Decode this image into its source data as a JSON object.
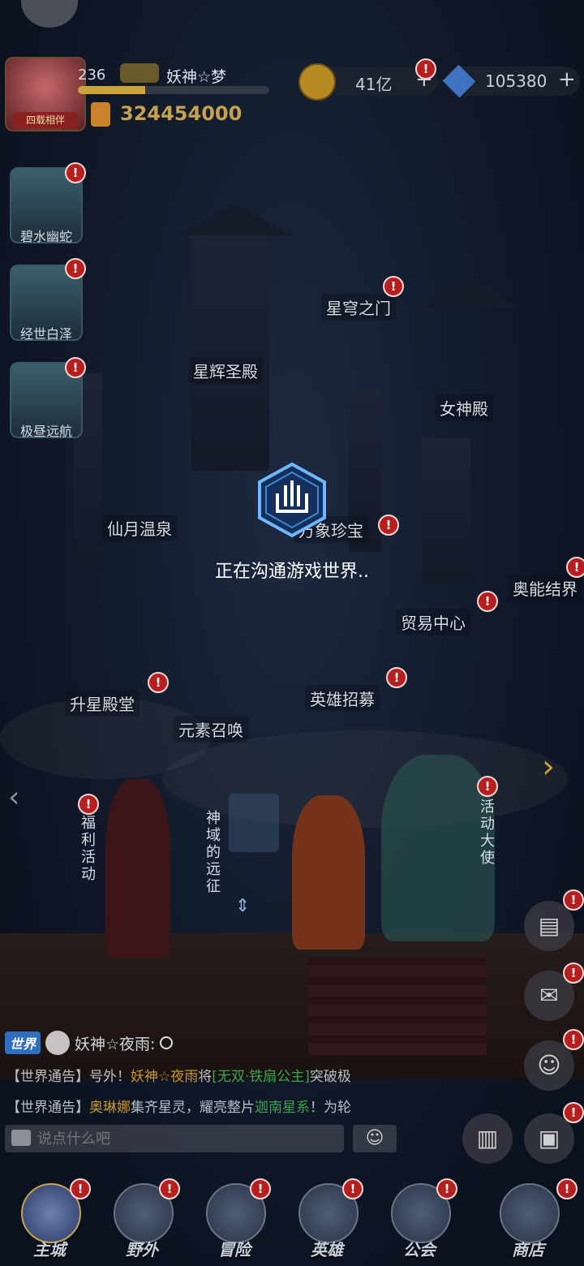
{
  "player": {
    "level": "236",
    "name": "妖神☆梦",
    "exp_progress": 0.35,
    "power": "324454000",
    "avatar_tag": "四载相伴"
  },
  "resources": {
    "gold": "41亿",
    "gems": "105380",
    "plus": "+"
  },
  "alert": "!",
  "events": [
    {
      "label": "碧水幽蛇"
    },
    {
      "label": "经世白泽"
    },
    {
      "label": "极昼远航"
    }
  ],
  "buildings": {
    "star_gate": "星穹之门",
    "star_palace": "星辉圣殿",
    "goddess_hall": "女神殿",
    "moon_spring": "仙月温泉",
    "treasure": "万象珍宝",
    "energy_bond": "奥能结界",
    "trade_center": "贸易中心",
    "star_up_hall": "升星殿堂",
    "hero_recruit": "英雄招募",
    "element_summon": "元素召唤"
  },
  "loading": {
    "text": "正在沟通游戏世界.."
  },
  "vertical_labels": {
    "welfare": "福利活动",
    "expedition": "神域的远征",
    "ambassador": "活动大使"
  },
  "chat": {
    "channel": "世界",
    "speaker": "妖神☆夜雨:",
    "line1": {
      "prefix": "【世界通告】号外！",
      "name": "妖神☆夜雨",
      "mid": "将",
      "item": "[无双·铁扇公主]",
      "suffix": "突破极"
    },
    "line2": {
      "prefix": "【世界通告】",
      "name": "奥琳娜",
      "mid": "集齐星灵，耀亮整片",
      "item": "迦南星系",
      "suffix": "！为轮"
    },
    "placeholder": "说点什么吧",
    "emoji": "☺"
  },
  "nav": [
    {
      "label": "主城",
      "active": true
    },
    {
      "label": "野外"
    },
    {
      "label": "冒险"
    },
    {
      "label": "英雄"
    },
    {
      "label": "公会"
    },
    {
      "label": "商店"
    }
  ],
  "side_buttons": [
    {
      "icon": "notebook-icon"
    },
    {
      "icon": "mail-icon"
    },
    {
      "icon": "friends-icon"
    },
    {
      "icon": "backpack-icon"
    },
    {
      "icon": "ranking-icon"
    }
  ],
  "colors": {
    "alert_red": "#b71e1e",
    "power_gold": "#c7a24e",
    "world_tag": "#2f6fc0",
    "name_yellow": "#c9982d",
    "item_green": "#39a64a"
  }
}
